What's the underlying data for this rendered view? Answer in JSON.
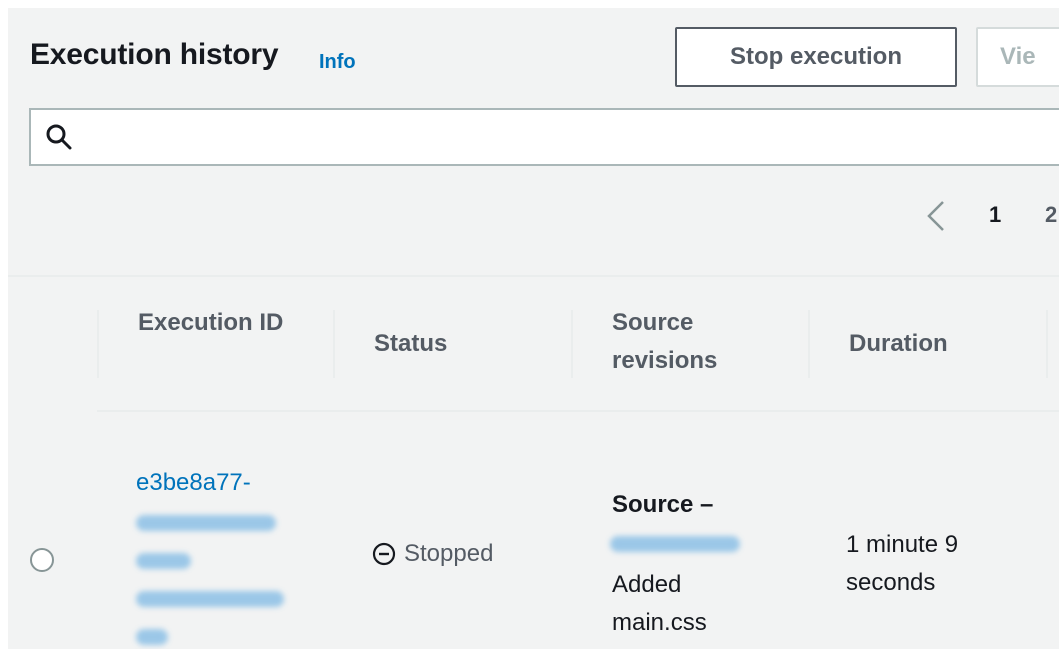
{
  "header": {
    "title": "Execution history",
    "info_label": "Info",
    "stop_button": "Stop execution",
    "view_button": "Vie"
  },
  "search": {
    "placeholder": "",
    "value": ""
  },
  "pagination": {
    "current": "1",
    "next": "2"
  },
  "table": {
    "columns": [
      "Execution ID",
      "Status",
      "Source revisions",
      "Duration"
    ],
    "rows": [
      {
        "execution_id_visible": "e3be8a77-",
        "status": "Stopped",
        "source_label": "Source –",
        "source_message": "Added main.css",
        "duration": "1 minute 9 seconds"
      }
    ]
  },
  "colors": {
    "link": "#0073bb",
    "panel_bg": "#f2f3f3",
    "text": "#16191f",
    "muted": "#545b64"
  },
  "icons": {
    "search": "search-icon",
    "prev": "chevron-left-icon",
    "status": "stopped-icon"
  }
}
